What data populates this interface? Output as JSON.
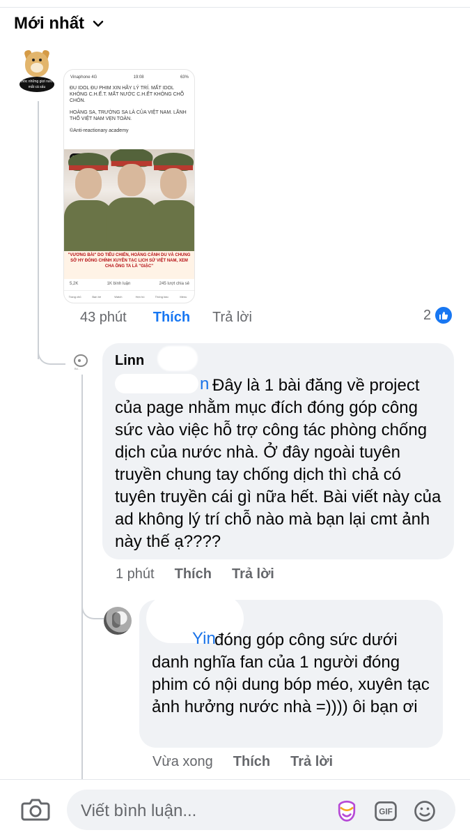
{
  "header": {
    "sort_label": "Mới nhất"
  },
  "post": {
    "screenshot": {
      "status_left": "Vinaphone 4G",
      "status_time": "19:08",
      "status_right": "63%",
      "paragraphs": [
        "ĐU IDOL ĐU PHIM XIN HÃY LÝ TRÍ. MẤT IDOL KHÔNG C.H.Ế.T. MẤT NƯỚC C.H.ẾT KHÔNG CHỖ CHÔN.",
        "HOÀNG SA, TRƯỜNG SA LÀ CỦA VIỆT NAM. LÃNH THỔ VIỆT NAM VẸN TOÀN.",
        "©Anti-reactionary academy"
      ],
      "logo": "LOVE",
      "banner": "\"VƯƠNG BÀI\" DO TIÊU CHIẾN, HOÀNG CẢNH DU VÀ CHUNG SỞ HY ĐÓNG CHÍNH XUYÊN TẠC LỊCH SỬ VIỆT NAM, XEM CHA ÔNG TA LÀ \"GIẶC\"",
      "reactions": "5,2K",
      "comments": "1K bình luận",
      "shares": "245 lượt chia sẻ",
      "nav": [
        "Trang chủ",
        "Bạn bè",
        "Watch",
        "Hẹn hò",
        "Thông báo",
        "Menu"
      ]
    },
    "time": "43 phút",
    "like_label": "Thích",
    "reply_label": "Trả lời",
    "reaction_count": "2"
  },
  "comments": [
    {
      "name": "Linn",
      "mention_tail": "n",
      "text": "Đây là 1 bài đăng về project của page nhằm mục đích đóng góp công sức vào việc hỗ trợ công tác phòng chống dịch của nước nhà. Ở đây ngoài tuyên truyền chung tay chống dịch thì chả có tuyên truyền cái gì nữa hết. Bài viết này của ad không lý trí chỗ nào mà bạn lại cmt ảnh này thế ạ????",
      "time": "1 phút",
      "like_label": "Thích",
      "reply_label": "Trả lời"
    },
    {
      "mention": "Yin",
      "text": "đóng góp công sức dưới danh nghĩa fan của 1 người đóng phim có nội dung bóp méo, xuyên tạc ảnh hưởng nước nhà =)))) ôi bạn ơi",
      "time": "Vừa xong",
      "like_label": "Thích",
      "reply_label": "Trả lời"
    }
  ],
  "composer": {
    "placeholder": "Viết bình luận...",
    "gif_label": "GIF"
  },
  "colors": {
    "accent": "#1877f2",
    "muted": "#65676b",
    "bubble": "#f0f2f5"
  }
}
